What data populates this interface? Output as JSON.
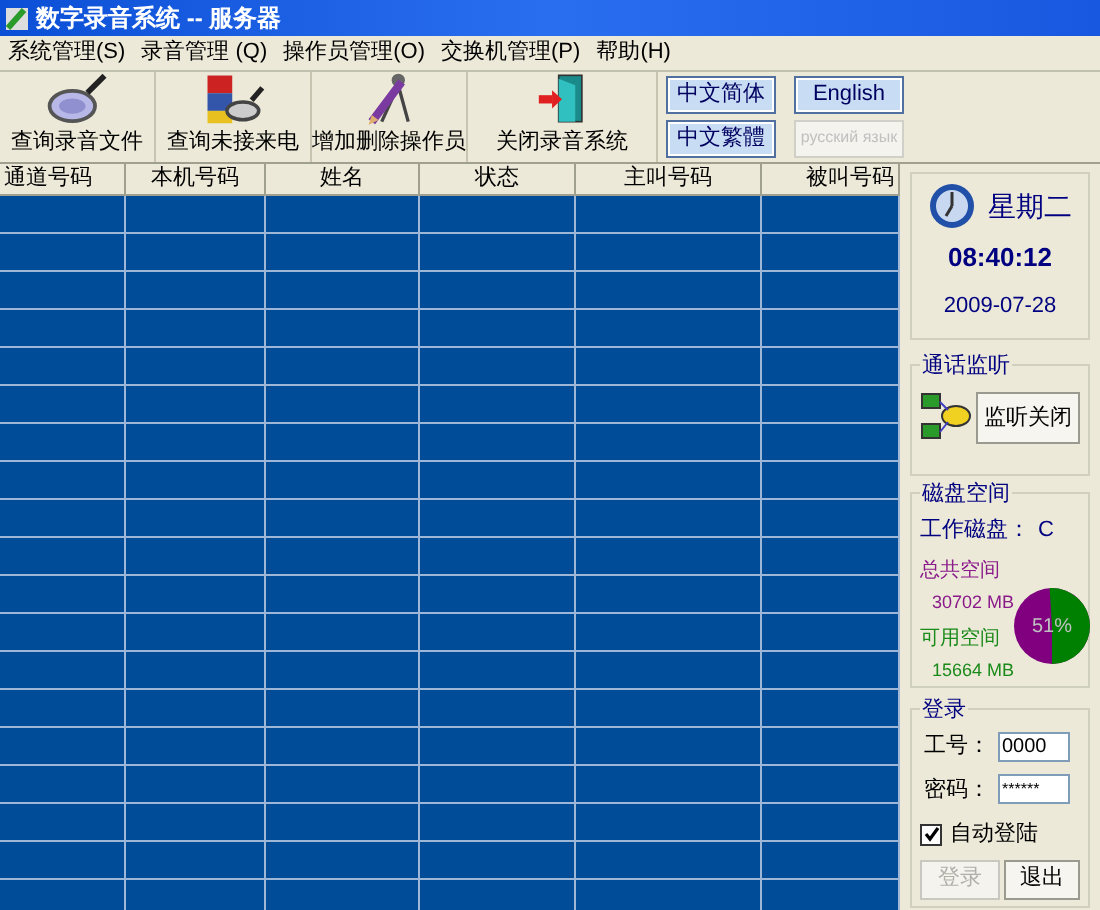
{
  "window": {
    "title": "数字录音系统 -- 服务器"
  },
  "menu": [
    {
      "label": "系统管理(S)"
    },
    {
      "label": "录音管理 (Q)"
    },
    {
      "label": "操作员管理(O)"
    },
    {
      "label": "交换机管理(P)"
    },
    {
      "label": "帮助(H)"
    }
  ],
  "toolbar": [
    {
      "label": "查询录音文件",
      "kind": "search"
    },
    {
      "label": "查询未接来电",
      "kind": "missed"
    },
    {
      "label": "增加删除操作员",
      "kind": "operator"
    },
    {
      "label": "关闭录音系统",
      "kind": "exit"
    }
  ],
  "languages": [
    {
      "label": "中文简体",
      "disabled": false
    },
    {
      "label": "English",
      "disabled": false
    },
    {
      "label": "中文繁體",
      "disabled": false
    },
    {
      "label": "русский язык",
      "disabled": true
    }
  ],
  "table": {
    "columns": [
      "通道号码",
      "本机号码",
      "姓名",
      "状态",
      "主叫号码",
      "被叫号码"
    ]
  },
  "clock": {
    "weekday": "星期二",
    "time": "08:40:12",
    "date": "2009-07-28"
  },
  "monitor": {
    "title": "通话监听",
    "button": "监听关闭"
  },
  "disk": {
    "title": "磁盘空间",
    "drive_label": "工作磁盘：",
    "drive": "C",
    "total_label": "总共空间",
    "total": "30702 MB",
    "free_label": "可用空间",
    "free": "15664 MB",
    "level": 0.51,
    "percent": "51%"
  },
  "login": {
    "title": "登录",
    "id_label": "工号：",
    "id_value": "0000",
    "password_label": "密码：",
    "password_value": "******",
    "auto_login": {
      "label": "自动登陆",
      "checked": true
    },
    "login_button": {
      "label": "登录",
      "disabled": true
    },
    "exit_button": {
      "label": "退出",
      "disabled": false
    }
  }
}
